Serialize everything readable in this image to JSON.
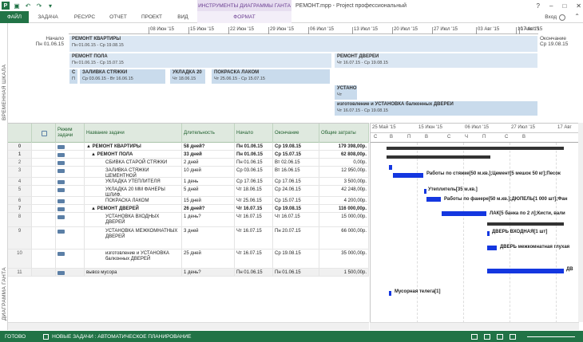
{
  "titlebar": {
    "context_tab_title": "ИНСТРУМЕНТЫ ДИАГРАММЫ ГАНТА",
    "doc_title": "РЕМОНТ.mpp - Project профессиональный",
    "help": "?",
    "minimize": "–",
    "restore": "□",
    "close": "✕"
  },
  "ribbon": {
    "tabs": [
      "ФАЙЛ",
      "ЗАДАЧА",
      "РЕСУРС",
      "ОТЧЕТ",
      "ПРОЕКТ",
      "ВИД",
      "ФОРМАТ"
    ],
    "user": "Вход"
  },
  "timeline": {
    "side_label": "ВРЕМЕННАЯ ШКАЛА",
    "start_label": "Начало",
    "start_date": "Пн 01.06.15",
    "finish_label": "Окончание",
    "finish_date": "Ср 19.08.15",
    "ticks": [
      "08 Июн '15",
      "15 Июн '15",
      "22 Июн '15",
      "29 Июн '15",
      "06 Июл '15",
      "13 Июл '15",
      "20 Июл '15",
      "27 Июл '15",
      "03 Авг '15",
      "10 Авг '15",
      "17 Авг '15"
    ],
    "bars": [
      {
        "name": "РЕМОНТ КВАРТИРЫ",
        "dates": "Пн 01.06.15 - Ср 19.08.15"
      },
      {
        "name": "РЕМОНТ ПОЛА",
        "dates": "Пн 01.06.15 - Ср 15.07.15"
      },
      {
        "name": "РЕМОНТ ДВЕРЕЙ",
        "dates": "Чт 16.07.15 - Ср 19.08.15"
      },
      {
        "name": "С",
        "dates": "П"
      },
      {
        "name": "ЗАЛИВКА СТЯЖКИ",
        "dates": "Ср 03.06.15 - Вт 16.06.15"
      },
      {
        "name": "УКЛАДКА 20",
        "dates": "Чт 18.06.15"
      },
      {
        "name": "ПОКРАСКА ЛАКОМ",
        "dates": "Чт 25.06.15 - Ср 15.07.15"
      },
      {
        "name": "УСТАНО",
        "dates": "Чт"
      },
      {
        "name": "изготовление и УСТАНОВКА  балконных  ДВЕРЕЙ",
        "dates": "Чт 16.07.15 - Ср 19.08.15"
      }
    ]
  },
  "table": {
    "side_label": "ДИАГРАММА ГАНТА",
    "headers": [
      "",
      "",
      "Режим задачи",
      "Название задачи",
      "Длительность",
      "Начало",
      "Окончание",
      "Общие затраты"
    ],
    "rows": [
      {
        "id": "0",
        "name": "▲ РЕМОНТ КВАРТИРЫ",
        "dur": "58 дней?",
        "start": "Пн 01.06.15",
        "finish": "Ср 19.08.15",
        "cost": "179 398,00р.",
        "summary": true
      },
      {
        "id": "1",
        "name": "▲ РЕМОНТ ПОЛА",
        "dur": "33 дней",
        "start": "Пн 01.06.15",
        "finish": "Ср 15.07.15",
        "cost": "62 808,00р.",
        "summary": true
      },
      {
        "id": "2",
        "name": "СБИВКА СТАРОЙ СТЯЖКИ",
        "dur": "2 дней",
        "start": "Пн 01.06.15",
        "finish": "Вт 02.06.15",
        "cost": "0,00р."
      },
      {
        "id": "3",
        "name": "ЗАЛИВКА СТЯЖКИ ЦЕМЕНТНОЙ",
        "dur": "10 дней",
        "start": "Ср 03.06.15",
        "finish": "Вт 16.06.15",
        "cost": "12 950,00р."
      },
      {
        "id": "4",
        "name": "УКЛАДКА УТЕПЛИТЕЛЯ",
        "dur": "1 день",
        "start": "Ср 17.06.15",
        "finish": "Ср 17.06.15",
        "cost": "3 500,00р."
      },
      {
        "id": "5",
        "name": "УКЛАДКА 20 ММ ФАНЕРЫ ШЛИФ.",
        "dur": "5 дней",
        "start": "Чт 18.06.15",
        "finish": "Ср 24.06.15",
        "cost": "42 248,00р."
      },
      {
        "id": "6",
        "name": "ПОКРАСКА ЛАКОМ",
        "dur": "15 дней",
        "start": "Чт 25.06.15",
        "finish": "Ср 15.07.15",
        "cost": "4 200,00р."
      },
      {
        "id": "7",
        "name": "▲ РЕМОНТ ДВЕРЕЙ",
        "dur": "26 дней?",
        "start": "Чт 16.07.15",
        "finish": "Ср 19.08.15",
        "cost": "116 000,00р.",
        "summary": true
      },
      {
        "id": "8",
        "name": "УСТАНОВКА  ВХОДНЫХ ДВЕРЕЙ",
        "dur": "1 день?",
        "start": "Чт 16.07.15",
        "finish": "Чт 16.07.15",
        "cost": "15 000,00р."
      },
      {
        "id": "9",
        "name": "УСТАНОВКА МЕЖКОМНАТНЫХ  ДВЕРЕЙ",
        "dur": "3 дней",
        "start": "Чт 16.07.15",
        "finish": "Пн 20.07.15",
        "cost": "66 000,00р."
      },
      {
        "id": "10",
        "name": "изготовление и УСТАНОВКА  балконных  ДВЕРЕЙ",
        "dur": "25 дней",
        "start": "Чт 16.07.15",
        "finish": "Ср 19.08.15",
        "cost": "35 000,00р."
      },
      {
        "id": "11",
        "name": "вывоз мусора",
        "dur": "1 день?",
        "start": "Пн 01.06.15",
        "finish": "Пн 01.06.15",
        "cost": "1 500,00р.",
        "selected": true
      }
    ]
  },
  "gantt": {
    "weeks": [
      "25 Май '15",
      "15 Июн '15",
      "06 Июл '15",
      "27 Июл '15",
      "17 Авг"
    ],
    "days": [
      "С",
      "В",
      "П",
      "В",
      "С",
      "Ч",
      "П",
      "С",
      "В"
    ],
    "labels": [
      "Работы по стяжке[50 м.кв.];Цемент[5 мешок 50 кг];Песок",
      "Утеплитель[35 м.кв.]",
      "Работы по фанере[50 м.кв.];ДЮПЕЛЬ[1 000 шт];Фан",
      "ЛАК[5 банка по 2 л];Кисти, вали",
      "ДВЕРЬ ВХОДНАЯ[1 шт]",
      "ДВЕРЬ межкомнатная глухая",
      "ДВ",
      "Мусорная телега[1]"
    ]
  },
  "status": {
    "ready": "ГОТОВО",
    "mode": "НОВЫЕ ЗАДАЧИ : АВТОМАТИЧЕСКОЕ ПЛАНИРОВАНИЕ"
  }
}
